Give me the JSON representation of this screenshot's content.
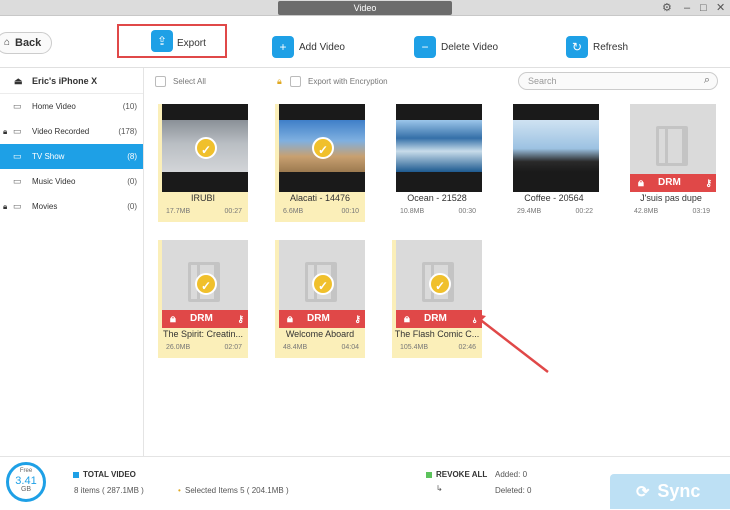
{
  "window": {
    "title": "Video"
  },
  "toolbar": {
    "back_label": "Back",
    "export_label": "Export",
    "add_label": "Add Video",
    "delete_label": "Delete Video",
    "refresh_label": "Refresh"
  },
  "sidebar": {
    "device": "Eric's iPhone X",
    "items": [
      {
        "label": "Home Video",
        "count": "(10)",
        "icon": "home-video-icon",
        "locked": false
      },
      {
        "label": "Video Recorded",
        "count": "(178)",
        "icon": "video-recorded-icon",
        "locked": true
      },
      {
        "label": "TV Show",
        "count": "(8)",
        "icon": "tv-icon",
        "locked": false
      },
      {
        "label": "Music Video",
        "count": "(0)",
        "icon": "music-video-icon",
        "locked": false
      },
      {
        "label": "Movies",
        "count": "(0)",
        "icon": "movies-icon",
        "locked": true
      }
    ]
  },
  "subbar": {
    "select_all": "Select All",
    "export_encryption": "Export with Encryption",
    "search_placeholder": "Search"
  },
  "videos": [
    {
      "name": "IRUBI",
      "size": "17.7MB",
      "duration": "00:27",
      "selected": true,
      "drm": false
    },
    {
      "name": "Alacati - 14476",
      "size": "6.6MB",
      "duration": "00:10",
      "selected": true,
      "drm": false
    },
    {
      "name": "Ocean - 21528",
      "size": "10.8MB",
      "duration": "00:30",
      "selected": false,
      "drm": false
    },
    {
      "name": "Coffee - 20564",
      "size": "29.4MB",
      "duration": "00:22",
      "selected": false,
      "drm": false
    },
    {
      "name": "J'suis pas dupe",
      "size": "42.8MB",
      "duration": "03:19",
      "selected": false,
      "drm": true
    },
    {
      "name": "The Spirit: Creatin...",
      "size": "26.0MB",
      "duration": "02:07",
      "selected": true,
      "drm": true
    },
    {
      "name": "Welcome Aboard",
      "size": "48.4MB",
      "duration": "04:04",
      "selected": true,
      "drm": true
    },
    {
      "name": "The Flash Comic C...",
      "size": "105.4MB",
      "duration": "02:46",
      "selected": true,
      "drm": true
    }
  ],
  "drm_label": "DRM",
  "status": {
    "free_label": "Free",
    "free_value": "3.41",
    "free_unit": "GB",
    "total_label": "TOTAL VIDEO",
    "items": "8 items ( 287.1MB )",
    "selected": "Selected Items 5 ( 204.1MB )",
    "revoke_label": "REVOKE ALL",
    "added": "Added: 0",
    "deleted": "Deleted: 0",
    "sync_label": "Sync"
  },
  "colors": {
    "accent": "#1ea0e6",
    "selection": "#fbefb9",
    "drm": "#e04848",
    "highlight": "#e04848"
  }
}
